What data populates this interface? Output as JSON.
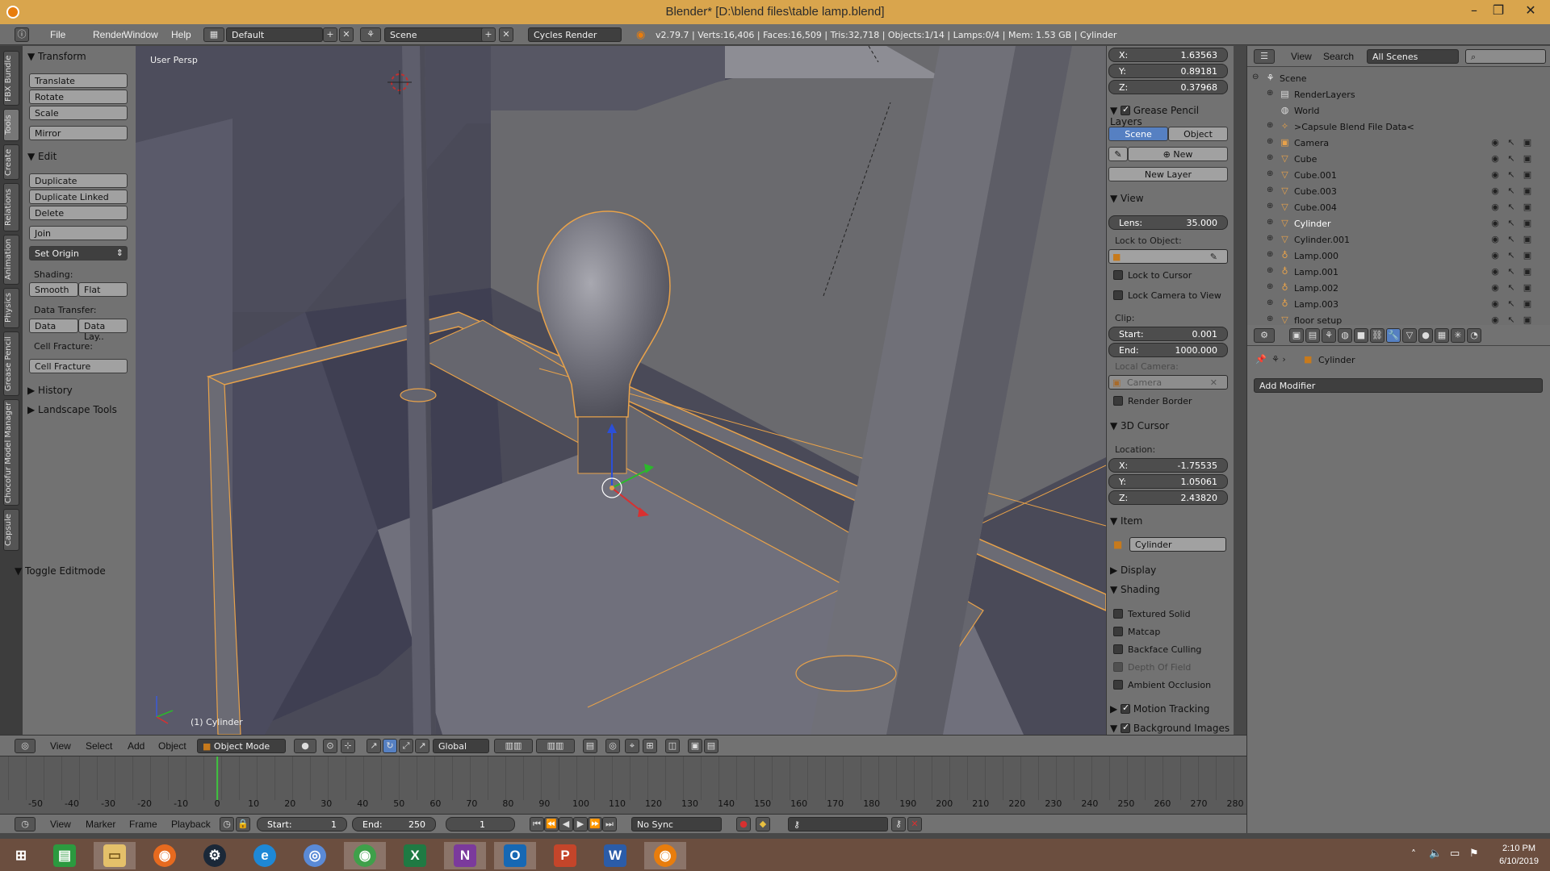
{
  "window": {
    "title": "Blender* [D:\\blend files\\table lamp.blend]",
    "minimize": "–",
    "maximize": "❐",
    "close": "✕"
  },
  "info_header": {
    "menus": [
      "File",
      "Render",
      "Window",
      "Help"
    ],
    "layout": "Default",
    "scene": "Scene",
    "engine": "Cycles Render",
    "stats": "v2.79.7 | Verts:16,406 | Faces:16,509 | Tris:32,718 | Objects:1/14 | Lamps:0/4 | Mem: 1.53 GB | Cylinder"
  },
  "vtabs": [
    "FBX Bundle",
    "Tools",
    "Create",
    "Relations",
    "Animation",
    "Physics",
    "Grease Pencil",
    "Chocofur Model Manager",
    "Capsule"
  ],
  "toolshelf": {
    "transform_header": "Transform",
    "transform": [
      "Translate",
      "Rotate",
      "Scale",
      "Mirror"
    ],
    "edit_header": "Edit",
    "edit": [
      "Duplicate",
      "Duplicate Linked",
      "Delete",
      "Join"
    ],
    "set_origin": "Set Origin",
    "shading_label": "Shading:",
    "smooth": "Smooth",
    "flat": "Flat",
    "data_transfer_label": "Data Transfer:",
    "data": "Data",
    "data_layout": "Data Lay..",
    "cell_fracture_label": "Cell Fracture:",
    "cell_fracture": "Cell Fracture",
    "history": "History",
    "landscape_tools": "Landscape Tools",
    "toggle_editmode": "Toggle Editmode"
  },
  "viewport": {
    "view_name": "User Persp",
    "active_object": "(1) Cylinder"
  },
  "npanel": {
    "location": {
      "x": "1.63563",
      "y": "0.89181",
      "z": "0.37968"
    },
    "grease_pencil_header": "Grease Pencil Layers",
    "gp_scene": "Scene",
    "gp_object": "Object",
    "gp_new": "New",
    "gp_new_layer": "New Layer",
    "view_header": "View",
    "lens_label": "Lens:",
    "lens_value": "35.000",
    "lock_to_object_label": "Lock to Object:",
    "lock_to_cursor": "Lock to Cursor",
    "lock_camera": "Lock Camera to View",
    "clip_label": "Clip:",
    "clip_start_label": "Start:",
    "clip_start": "0.001",
    "clip_end_label": "End:",
    "clip_end": "1000.000",
    "local_camera_label": "Local Camera:",
    "local_camera": "Camera",
    "render_border": "Render Border",
    "cursor_header": "3D Cursor",
    "cursor_location_label": "Location:",
    "cursor": {
      "x": "-1.75535",
      "y": "1.05061",
      "z": "2.43820"
    },
    "item_header": "Item",
    "item_name": "Cylinder",
    "display_header": "Display",
    "shading_header": "Shading",
    "textured_solid": "Textured Solid",
    "matcap": "Matcap",
    "backface_culling": "Backface Culling",
    "depth_of_field": "Depth Of Field",
    "ambient_occlusion": "Ambient Occlusion",
    "motion_tracking": "Motion Tracking",
    "background_images": "Background Images",
    "x_label": "X:",
    "y_label": "Y:",
    "z_label": "Z:"
  },
  "outliner": {
    "view": "View",
    "search": "Search",
    "filter": "All Scenes",
    "items": [
      {
        "name": "Scene",
        "icon": "scene-icon"
      },
      {
        "name": "RenderLayers",
        "icon": "renderlayers-icon"
      },
      {
        "name": "World",
        "icon": "world-icon"
      },
      {
        "name": ">Capsule Blend File Data<",
        "icon": "empty-icon"
      },
      {
        "name": "Camera",
        "icon": "camera-icon"
      },
      {
        "name": "Cube",
        "icon": "mesh-icon"
      },
      {
        "name": "Cube.001",
        "icon": "mesh-icon"
      },
      {
        "name": "Cube.003",
        "icon": "mesh-icon"
      },
      {
        "name": "Cube.004",
        "icon": "mesh-icon"
      },
      {
        "name": "Cylinder",
        "icon": "mesh-icon"
      },
      {
        "name": "Cylinder.001",
        "icon": "mesh-icon"
      },
      {
        "name": "Lamp.000",
        "icon": "lamp-icon"
      },
      {
        "name": "Lamp.001",
        "icon": "lamp-icon"
      },
      {
        "name": "Lamp.002",
        "icon": "lamp-icon"
      },
      {
        "name": "Lamp.003",
        "icon": "lamp-icon"
      },
      {
        "name": "floor setup",
        "icon": "mesh-icon"
      }
    ]
  },
  "properties": {
    "object_name": "Cylinder",
    "add_modifier": "Add Modifier"
  },
  "viewport_header": {
    "menus": [
      "View",
      "Select",
      "Add",
      "Object"
    ],
    "mode": "Object Mode",
    "orientation": "Global"
  },
  "timeline": {
    "ticks": [
      "-50",
      "-40",
      "-30",
      "-20",
      "-10",
      "0",
      "10",
      "20",
      "30",
      "40",
      "50",
      "60",
      "70",
      "80",
      "90",
      "100",
      "110",
      "120",
      "130",
      "140",
      "150",
      "160",
      "170",
      "180",
      "190",
      "200",
      "210",
      "220",
      "230",
      "240",
      "250",
      "260",
      "270",
      "280"
    ],
    "current_frame_tick": "0",
    "menus": [
      "View",
      "Marker",
      "Frame",
      "Playback"
    ],
    "start_label": "Start:",
    "start": "1",
    "end_label": "End:",
    "end": "250",
    "current": "1",
    "sync": "No Sync"
  },
  "taskbar": {
    "apps": [
      "start",
      "store",
      "file-explorer",
      "firefox",
      "steam",
      "internet-explorer",
      "chromium",
      "chrome",
      "excel",
      "onenote",
      "outlook",
      "powerpoint",
      "word",
      "blender"
    ],
    "time": "2:10 PM",
    "date": "6/10/2019"
  },
  "colors": {
    "selection_outline": "#e8a24a",
    "accent_blue": "#5680c2",
    "title_bar": "#d9a54d"
  }
}
